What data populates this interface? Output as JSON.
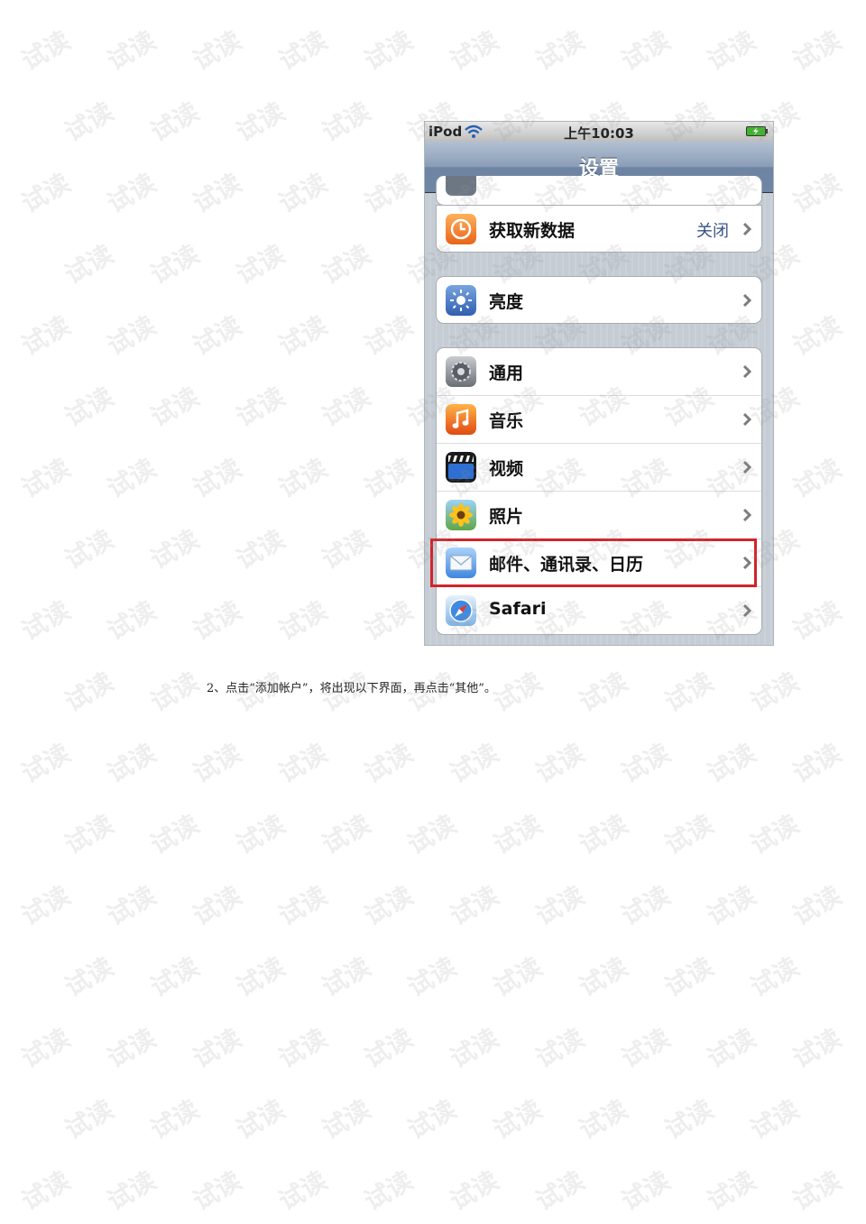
{
  "status_bar": {
    "carrier": "iPod",
    "time": "上午10:03"
  },
  "nav": {
    "title": "设置"
  },
  "groups": [
    {
      "items": [
        {
          "label": "获取新数据",
          "value": "关闭",
          "icon": "clock-icon"
        }
      ]
    },
    {
      "items": [
        {
          "label": "亮度",
          "icon": "brightness-icon"
        }
      ]
    },
    {
      "items": [
        {
          "label": "通用",
          "icon": "gear-icon"
        },
        {
          "label": "音乐",
          "icon": "music-icon"
        },
        {
          "label": "视频",
          "icon": "video-icon"
        },
        {
          "label": "照片",
          "icon": "photos-icon"
        },
        {
          "label": "邮件、通讯录、日历",
          "icon": "mail-icon",
          "highlighted": true
        },
        {
          "label": "Safari",
          "icon": "safari-icon"
        }
      ]
    }
  ],
  "caption": "2、点击“添加帐户”，将出现以下界面，再点击“其他”。",
  "watermark": "试读",
  "colors": {
    "highlight": "#d2232a",
    "nav": "#6f86a4",
    "value_text": "#385487"
  }
}
